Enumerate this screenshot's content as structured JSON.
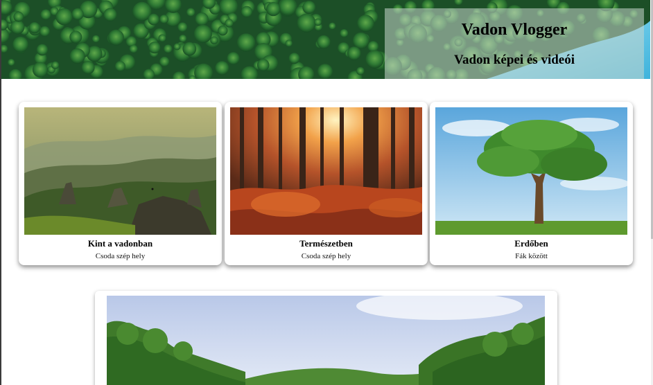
{
  "header": {
    "title": "Vadon Vlogger",
    "subtitle": "Vadon képei és videói",
    "image": "forest-aerial-image"
  },
  "gallery": {
    "cards": [
      {
        "title": "Kint a vadonban",
        "description": "Csoda szép hely",
        "image": "mountain-valley-image"
      },
      {
        "title": "Természetben",
        "description": "Csoda szép hely",
        "image": "autumn-forest-image"
      },
      {
        "title": "Erdőben",
        "description": "Fák között",
        "image": "lone-tree-image"
      }
    ]
  },
  "featured": {
    "image": "green-landscape-image"
  },
  "colors": {
    "forest_dark": "#1f5a2a",
    "water": "#5fc4e6",
    "title_box": "#c8d7cd",
    "card_bg": "#ffffff"
  }
}
